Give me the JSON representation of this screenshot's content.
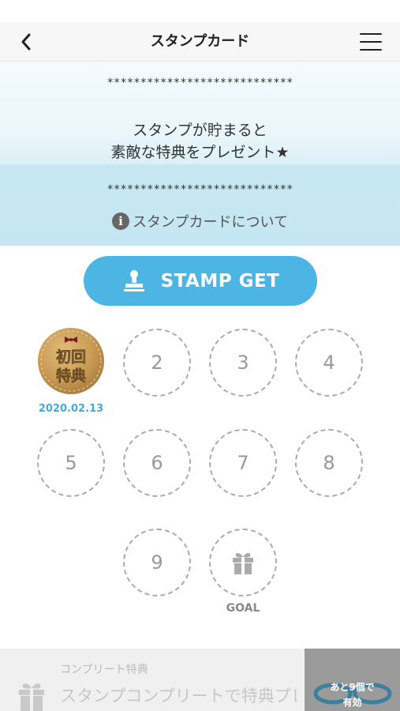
{
  "header": {
    "title": "スタンプカード"
  },
  "banner": {
    "decoration_top": "****************************",
    "message_line1": "スタンプが貯まると",
    "message_line2": "素敵な特典をプレゼント★",
    "decoration_bottom": "****************************",
    "about_link": "スタンプカードについて"
  },
  "stamp_button": {
    "label": "STAMP GET",
    "color": "#4db5e3"
  },
  "stamps": {
    "first": {
      "line1": "初回",
      "line2": "特典",
      "date": "2020.02.13"
    },
    "slots": [
      "2",
      "3",
      "4",
      "5",
      "6",
      "7",
      "8",
      "9"
    ],
    "goal_label": "GOAL"
  },
  "footer": {
    "title": "コンプリート特典",
    "text": "スタンプコンプリートで特典プレゼント",
    "badge_line1": "あと9個で",
    "badge_line2": "有効"
  }
}
